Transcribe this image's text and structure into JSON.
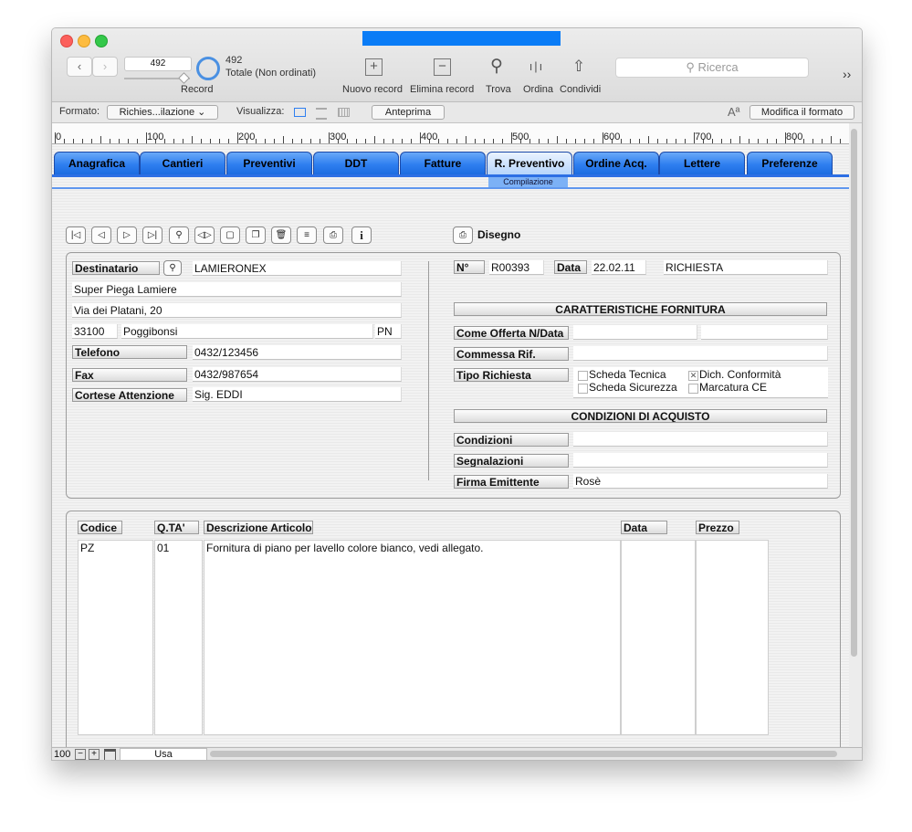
{
  "toolbar": {
    "record_value": "492",
    "record_label": "Record",
    "total_count": "492",
    "total_label": "Totale (Non ordinati)",
    "new_record": "Nuovo record",
    "delete_record": "Elimina record",
    "find": "Trova",
    "sort": "Ordina",
    "share": "Condividi",
    "search_placeholder": "Ricerca",
    "more": "››"
  },
  "formatbar": {
    "format_label": "Formato:",
    "format_value": "Richies...ilazione",
    "view_label": "Visualizza:",
    "preview": "Anteprima",
    "modify": "Modifica il formato",
    "font_icon": "Aª"
  },
  "ruler": {
    "labels": [
      "0",
      "100",
      "200",
      "300",
      "400",
      "500",
      "600",
      "700",
      "800"
    ]
  },
  "tabs": [
    "Anagrafica",
    "Cantieri",
    "Preventivi",
    "DDT",
    "Fatture",
    "R. Preventivo",
    "Ordine Acq.",
    "Lettere",
    "Preferenze"
  ],
  "subtab": "Compilazione",
  "record_buttons": [
    "first-record-icon",
    "prev-record-icon",
    "next-record-icon",
    "last-record-icon",
    "find-icon",
    "split-icon",
    "new-doc-icon",
    "duplicate-icon",
    "trash-icon",
    "list-icon",
    "print-icon",
    "info-icon"
  ],
  "record_button_glyphs": [
    "|◁",
    "◁",
    "▷",
    "▷|",
    "⚲",
    "◁▷",
    "▢",
    "❐",
    "🗑",
    "≡",
    "⎙",
    "i"
  ],
  "drawing": {
    "label": "Disegno",
    "glyph": "⎙"
  },
  "recipient": {
    "label": "Destinatario",
    "name": "LAMIERONEX",
    "company": "Super Piega Lamiere",
    "address": "Via dei Platani, 20",
    "zip": "33100",
    "city": "Poggibonsi",
    "province": "PN",
    "phone_label": "Telefono",
    "phone": "0432/123456",
    "fax_label": "Fax",
    "fax": "0432/987654",
    "attention_label": "Cortese Attenzione",
    "attention": "Sig. EDDI"
  },
  "header": {
    "number_label": "N°",
    "number": "R00393",
    "date_label": "Data",
    "date": "22.02.11",
    "type": "RICHIESTA"
  },
  "supply": {
    "section_title": "CARATTERISTICHE FORNITURA",
    "offer_label": "Come Offerta N/Data",
    "offer_value": "",
    "offer_date": "",
    "order_label": "Commessa Rif.",
    "order_value": "",
    "request_type_label": "Tipo Richiesta",
    "options": [
      {
        "label": "Scheda Tecnica",
        "checked": false
      },
      {
        "label": "Dich. Conformità",
        "checked": true
      },
      {
        "label": "Scheda Sicurezza",
        "checked": false
      },
      {
        "label": "Marcatura CE",
        "checked": false
      }
    ]
  },
  "purchase": {
    "section_title": "CONDIZIONI DI ACQUISTO",
    "conditions_label": "Condizioni",
    "conditions_value": "",
    "notes_label": "Segnalazioni",
    "notes_value": "",
    "signer_label": "Firma Emittente",
    "signer_value": "Rosè"
  },
  "items": {
    "headers": {
      "code": "Codice",
      "qty": "Q.TA'",
      "desc": "Descrizione Articolo",
      "date": "Data",
      "price": "Prezzo"
    },
    "rows": [
      {
        "code": "PZ",
        "qty": "01",
        "desc": "Fornitura di piano per lavello colore bianco, vedi allegato.",
        "date": "",
        "price": ""
      }
    ]
  },
  "statusbar": {
    "zoom": "100",
    "mode": "Usa"
  }
}
